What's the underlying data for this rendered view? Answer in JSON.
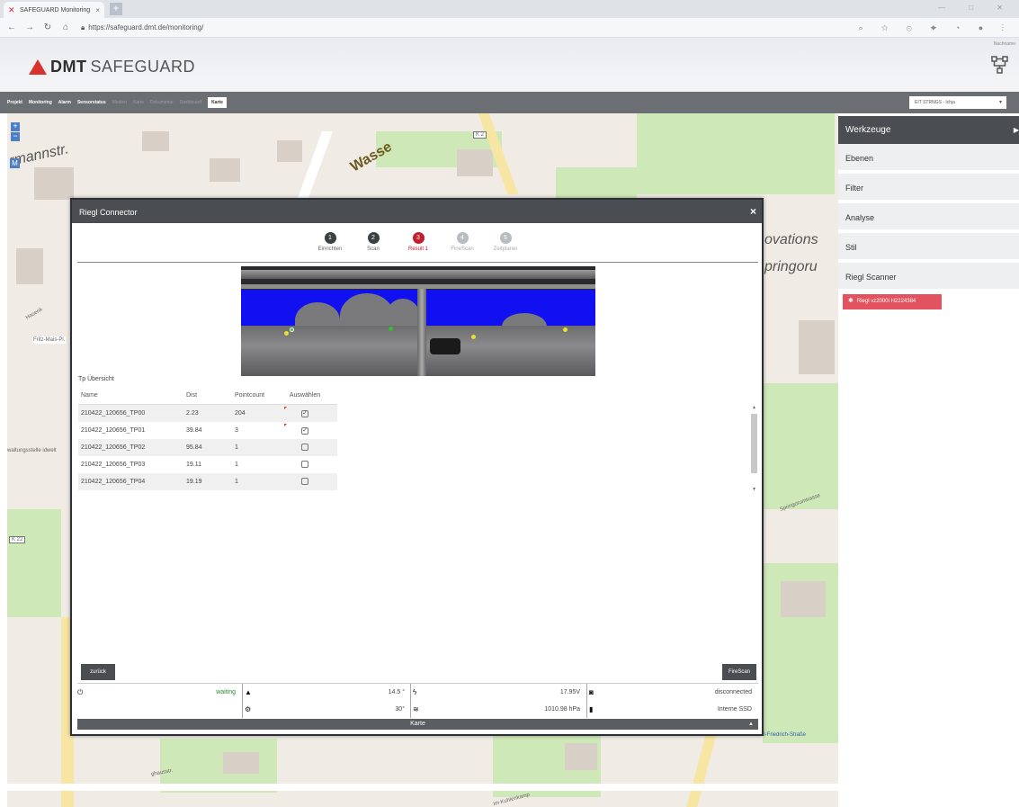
{
  "browser": {
    "tab_title": "SAFEGUARD Monitoring",
    "tab_close": "×",
    "new_tab": "+",
    "url": "https://safeguard.dmt.de/monitoring/"
  },
  "header": {
    "brand_bold": "DMT",
    "brand_light": "SAFEGUARD",
    "user": "Nachname"
  },
  "navbar": {
    "items": [
      {
        "label": "Projekt",
        "state": "normal"
      },
      {
        "label": "Monitoring",
        "state": "normal"
      },
      {
        "label": "Alarm",
        "state": "normal"
      },
      {
        "label": "Sensorstatus",
        "state": "normal"
      },
      {
        "label": "Medien",
        "state": "dim"
      },
      {
        "label": "Karte",
        "state": "dim"
      },
      {
        "label": "Dokumente",
        "state": "dim"
      },
      {
        "label": "Dashboard",
        "state": "dim"
      },
      {
        "label": "Karte",
        "state": "active"
      }
    ],
    "project_select": "EIT STRNGS - Ichja"
  },
  "map": {
    "zoom_in": "+",
    "zoom_out": "−",
    "layer_btn": "M",
    "labels": {
      "hermannstr": "rmannstr.",
      "innovations": "ovations",
      "springorum": "pringoru",
      "wasse": "Wasse",
      "k2": "K 2",
      "k22": "K 22",
      "hasenk": "Hasenk",
      "fritz": "Fritz-Mais-Pl.",
      "springorumtrasse": "Springorumtrasse",
      "kuhlenkamp": "Im Kuhlenkamp",
      "karl": "Karl-Friedrich-Straße",
      "ghausstr": "ghausstr.",
      "verwaltung": "waltungsstelle idwelt"
    }
  },
  "right_panel": {
    "header": "Werkzeuge",
    "items": [
      "Ebenen",
      "Filter",
      "Analyse",
      "Stil",
      "Riegl Scanner"
    ],
    "scanner_badge": "Riegl vz2000i H2224384"
  },
  "modal": {
    "title": "Riegl Connector",
    "close": "×",
    "steps": [
      {
        "num": "1",
        "label": "Einrichten",
        "state": "done"
      },
      {
        "num": "2",
        "label": "Scan",
        "state": "done"
      },
      {
        "num": "3",
        "label": "Result 1",
        "state": "active"
      },
      {
        "num": "4",
        "label": "FineScan",
        "state": "todo"
      },
      {
        "num": "5",
        "label": "Zeitplaner",
        "state": "todo"
      }
    ],
    "table_title": "Tp Übersicht",
    "columns": [
      "Name",
      "Dist",
      "Pointcount",
      "Auswählen"
    ],
    "rows": [
      {
        "name": "210422_120656_TP00",
        "dist": "2.23",
        "pointcount": "204",
        "selected": true
      },
      {
        "name": "210422_120656_TP01",
        "dist": "39.84",
        "pointcount": "3",
        "selected": true
      },
      {
        "name": "210422_120656_TP02",
        "dist": "95.84",
        "pointcount": "1",
        "selected": false
      },
      {
        "name": "210422_120656_TP03",
        "dist": "19.11",
        "pointcount": "1",
        "selected": false
      },
      {
        "name": "210422_120656_TP04",
        "dist": "19.19",
        "pointcount": "1",
        "selected": false
      }
    ],
    "back_button": "zurück",
    "firescan_button": "FireScan",
    "status": {
      "power": "waiting",
      "tilt": "14.5 °",
      "voltage": "17.95V",
      "camera": "disconnected",
      "temperature": "30°",
      "pressure": "1010.98 hPa",
      "storage": "Interne SSD"
    },
    "footer": "Karte"
  },
  "colors": {
    "brand_red": "#d9322c",
    "step_active": "#c22030",
    "status_waiting": "#2a8a2a",
    "badge": "#e2535f"
  }
}
